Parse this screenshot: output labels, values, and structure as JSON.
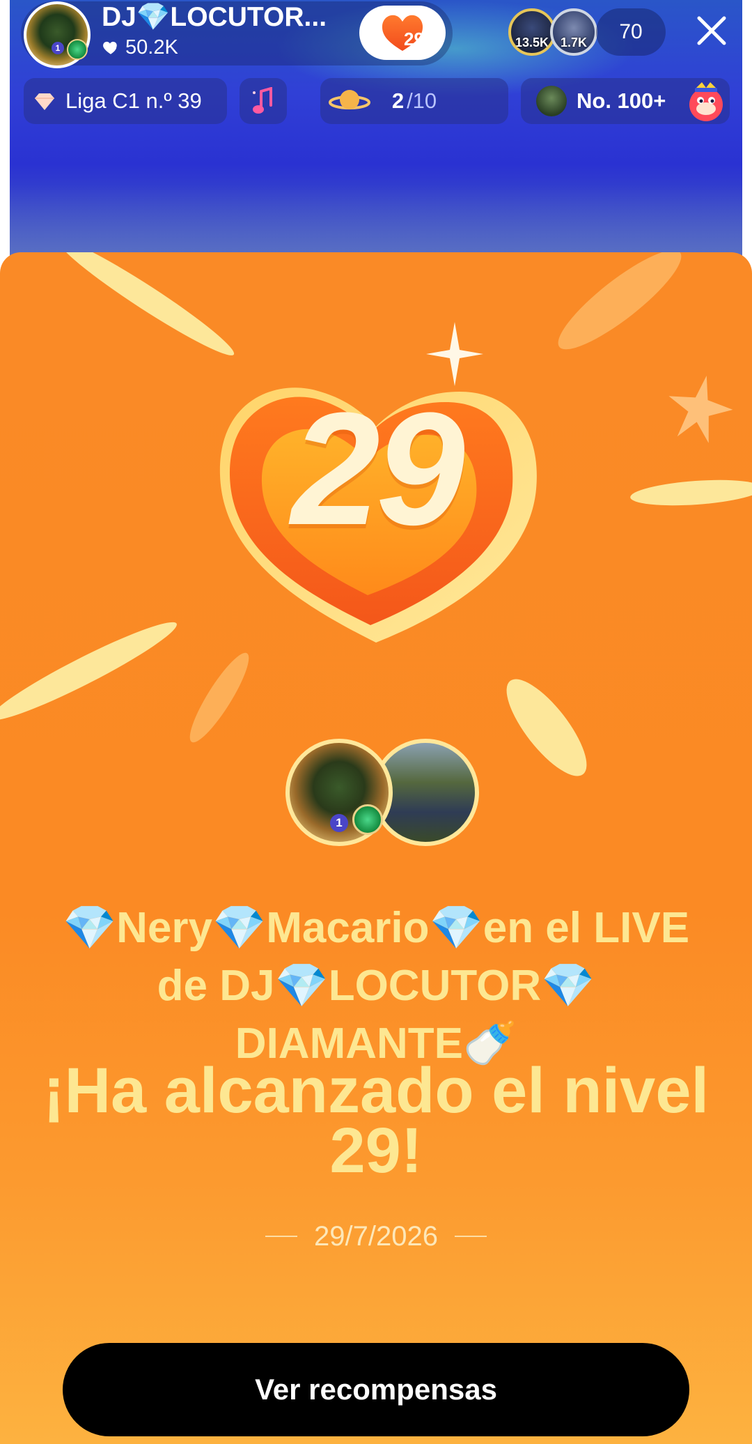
{
  "live_header": {
    "host_name": "DJ💎LOCUTOR...",
    "host_likes": "50.2K",
    "level_badge": "29",
    "viewers": [
      {
        "count": "13.5K"
      },
      {
        "count": "1.7K"
      }
    ],
    "viewer_total": "70",
    "chips": {
      "league": "Liga C1 n.º 39",
      "planet_current": "2",
      "planet_total": "/10",
      "rank": "No. 100+"
    },
    "icons": [
      "heart-icon",
      "close-icon",
      "diamond-icon",
      "music-note-icon",
      "planet-icon",
      "mascot-icon"
    ]
  },
  "level_up": {
    "level_number": "29",
    "message": "💎Nery💎Macario💎en el LIVE de DJ💎LOCUTOR💎 DIAMANTE🍼",
    "headline": "¡Ha alcanzado el nivel 29!",
    "date": "29/7/2026",
    "cta_label": "Ver recompensas"
  },
  "colors": {
    "sheet_orange": "#fb8a24",
    "accent_yellow": "#fde792",
    "live_blue": "#2a32d2",
    "cta_black": "#000000"
  }
}
